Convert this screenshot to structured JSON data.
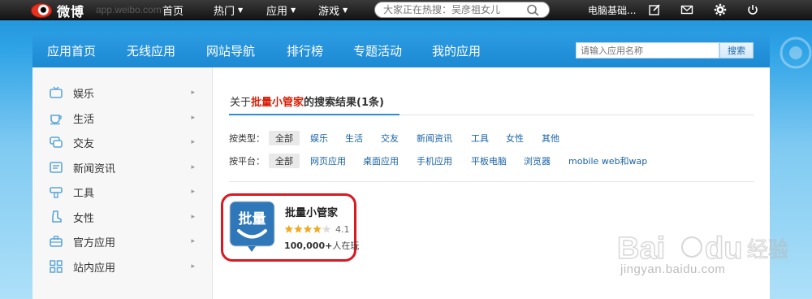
{
  "topbar": {
    "logo_text": "微博",
    "logo_sub": "app.weibo.com",
    "nav": [
      {
        "label": "首页",
        "has_caret": false
      },
      {
        "label": "热门",
        "has_caret": true
      },
      {
        "label": "应用",
        "has_caret": true
      },
      {
        "label": "游戏",
        "has_caret": true
      }
    ],
    "search_placeholder": "大家正在热搜：吴彦祖女儿",
    "user_name": "电脑基础...",
    "icons": [
      "edit-icon",
      "mail-icon",
      "gear-icon",
      "power-icon"
    ]
  },
  "navbar": {
    "items": [
      "应用首页",
      "无线应用",
      "网站导航",
      "排行榜",
      "专题活动",
      "我的应用"
    ],
    "search_placeholder": "请输入应用名称",
    "search_button": "搜索"
  },
  "sidebar": {
    "items": [
      {
        "label": "娱乐",
        "icon": "tv-icon"
      },
      {
        "label": "生活",
        "icon": "cup-icon"
      },
      {
        "label": "交友",
        "icon": "chat-icon"
      },
      {
        "label": "新闻资讯",
        "icon": "news-icon"
      },
      {
        "label": "工具",
        "icon": "tool-icon"
      },
      {
        "label": "女性",
        "icon": "boot-icon"
      },
      {
        "label": "官方应用",
        "icon": "briefcase-icon"
      },
      {
        "label": "站内应用",
        "icon": "grid-icon"
      }
    ]
  },
  "results": {
    "prefix": "关于",
    "keyword": "批量小管家",
    "suffix": "的搜索结果",
    "count": "(1条)"
  },
  "filters": {
    "type_label": "按类型：",
    "types": [
      "全部",
      "娱乐",
      "生活",
      "交友",
      "新闻资讯",
      "工具",
      "女性",
      "其他"
    ],
    "platform_label": "按平台：",
    "platforms": [
      "全部",
      "网页应用",
      "桌面应用",
      "手机应用",
      "平板电脑",
      "浏览器",
      "mobile web和wap"
    ]
  },
  "app": {
    "name": "批量小管家",
    "icon_text": "批量",
    "rating": "4.1",
    "rating_value": 4.1,
    "rating_max": 5,
    "players_count": "100,000+",
    "players_suffix": "人在玩"
  },
  "watermark": {
    "text": "jingyan.baidu.com"
  },
  "colors": {
    "accent": "#2a8fd8",
    "highlight": "#d9181f",
    "keyword": "#d81e06"
  }
}
